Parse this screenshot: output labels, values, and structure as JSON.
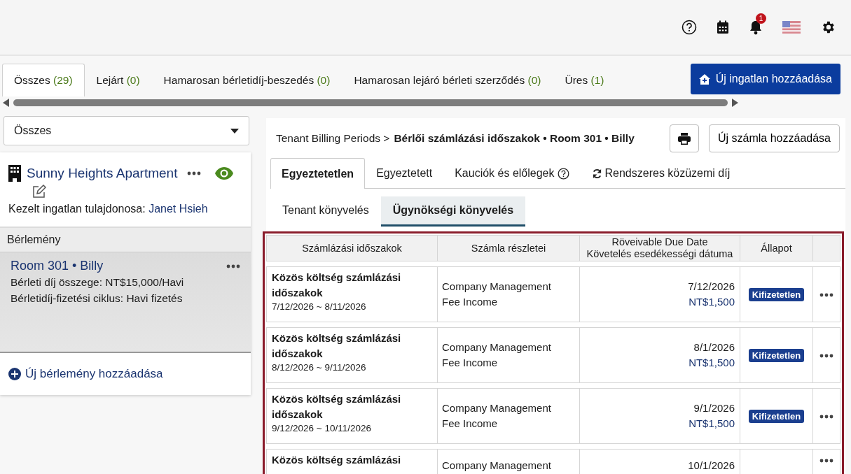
{
  "header": {
    "notification_count": "1"
  },
  "tabs": [
    {
      "label": "Összes",
      "count": "(29)",
      "selected": true
    },
    {
      "label": "Lejárt",
      "count": "(0)",
      "selected": false
    },
    {
      "label": "Hamarosan bérletidíj-beszedés",
      "count": "(0)",
      "selected": false
    },
    {
      "label": "Hamarosan lejáró bérleti szerződés",
      "count": "(0)",
      "selected": false
    },
    {
      "label": "Üres",
      "count": "(1)",
      "selected": false
    }
  ],
  "add_property_button": "Új ingatlan hozzáadása",
  "filter": {
    "value": "Összes"
  },
  "property": {
    "name": "Sunny Heights Apartment",
    "owner_label": "Kezelt ingatlan tulajdonosa:",
    "owner_name": "Janet Hsieh"
  },
  "units_section": "Bérlemény",
  "units": [
    {
      "title": "Room 301 • Billy",
      "rent": "Bérleti díj összege: NT$15,000/Havi",
      "cycle": "Bérletidíj-fizetési ciklus: Havi fizetés",
      "selected": true
    }
  ],
  "add_unit": "Új bérlemény hozzáadása",
  "breadcrumb": {
    "parent": "Tenant Billing Periods >",
    "current": "Bérlői számlázási időszakok • Room 301 • Billy"
  },
  "new_invoice_button": "Új számla hozzáadása",
  "view_tabs": [
    {
      "label": "Egyeztetetlen",
      "kind": "plain",
      "selected": true
    },
    {
      "label": "Egyeztetett",
      "kind": "plain",
      "selected": false
    },
    {
      "label": "Kauciók és előlegek",
      "kind": "help",
      "selected": false
    },
    {
      "label": "Rendszeres közüzemi díj",
      "kind": "refresh",
      "selected": false
    }
  ],
  "ledger_tabs": [
    {
      "label": "Tenant könyvelés",
      "selected": false
    },
    {
      "label": "Ügynökségi könyvelés",
      "selected": true
    }
  ],
  "table": {
    "columns": [
      {
        "label": "Számlázási időszakok"
      },
      {
        "label": "Számla részletei"
      },
      {
        "label": "Röveivable Due Date",
        "sublabel": "Követelés esedékességi dátuma"
      },
      {
        "label": "Állapot"
      }
    ],
    "rows": [
      {
        "title": "Közös költség számlázási időszakok",
        "range": "7/12/2026 ~ 8/11/2026",
        "detail": "Company Management Fee Income",
        "due_date": "7/12/2026",
        "amount": "NT$1,500",
        "status": "Kifizetetlen"
      },
      {
        "title": "Közös költség számlázási időszakok",
        "range": "8/12/2026 ~ 9/11/2026",
        "detail": "Company Management Fee Income",
        "due_date": "8/1/2026",
        "amount": "NT$1,500",
        "status": "Kifizetetlen"
      },
      {
        "title": "Közös költség számlázási időszakok",
        "range": "9/12/2026 ~ 10/11/2026",
        "detail": "Company Management Fee Income",
        "due_date": "9/1/2026",
        "amount": "NT$1,500",
        "status": "Kifizetetlen"
      },
      {
        "title": "Közös költség számlázási",
        "detail": "Company Management",
        "due_date": "10/1/2026"
      }
    ]
  }
}
